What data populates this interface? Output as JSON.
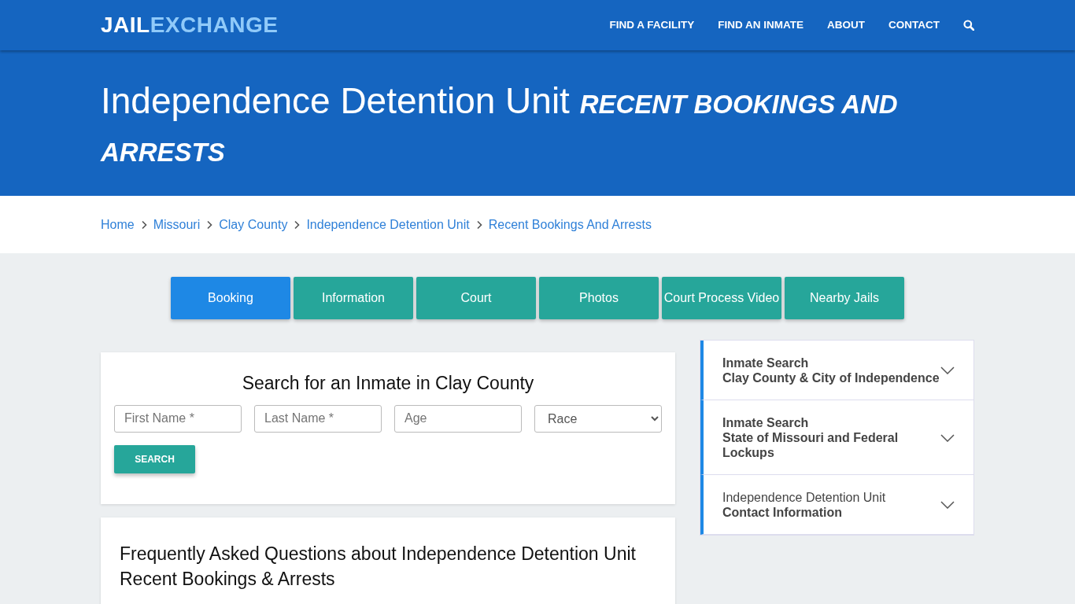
{
  "navbar": {
    "logo_parts": [
      "JAIL",
      "EXCHANGE"
    ],
    "links": [
      "FIND A FACILITY",
      "FIND AN INMATE",
      "ABOUT",
      "CONTACT"
    ]
  },
  "hero": {
    "title": "Independence Detention Unit",
    "subtitle": "RECENT BOOKINGS AND ARRESTS"
  },
  "breadcrumb": [
    "Home",
    "Missouri",
    "Clay County",
    "Independence Detention Unit",
    "Recent Bookings And Arrests"
  ],
  "tabs": [
    {
      "label": "Booking",
      "selected": true
    },
    {
      "label": "Information",
      "selected": false
    },
    {
      "label": "Court",
      "selected": false
    },
    {
      "label": "Photos",
      "selected": false
    },
    {
      "label": "Court Process Video",
      "selected": false
    },
    {
      "label": "Nearby Jails",
      "selected": false
    }
  ],
  "search_card": {
    "title": "Search for an Inmate in Clay County",
    "fields": [
      {
        "placeholder": "First Name *"
      },
      {
        "placeholder": "Last Name *"
      },
      {
        "placeholder": "Age"
      }
    ],
    "select": {
      "value": "Race"
    },
    "button": "SEARCH"
  },
  "faq": {
    "title": "Frequently Asked Questions about Independence Detention Unit Recent Bookings & Arrests"
  },
  "sidebar": {
    "items": [
      {
        "lines": [
          {
            "text": "Inmate Search",
            "bold": true
          },
          {
            "text": "Clay County & City of Independence",
            "bold": true
          }
        ],
        "expanded": false
      },
      {
        "lines": [
          {
            "text": "Inmate Search",
            "bold": true
          },
          {
            "text": "State of Missouri and Federal Lockups",
            "bold": true
          }
        ],
        "expanded": false
      },
      {
        "lines": [
          {
            "text": "Independence Detention Unit",
            "bold": false
          },
          {
            "text": "Contact Information",
            "bold": true
          }
        ],
        "expanded": false
      }
    ]
  }
}
